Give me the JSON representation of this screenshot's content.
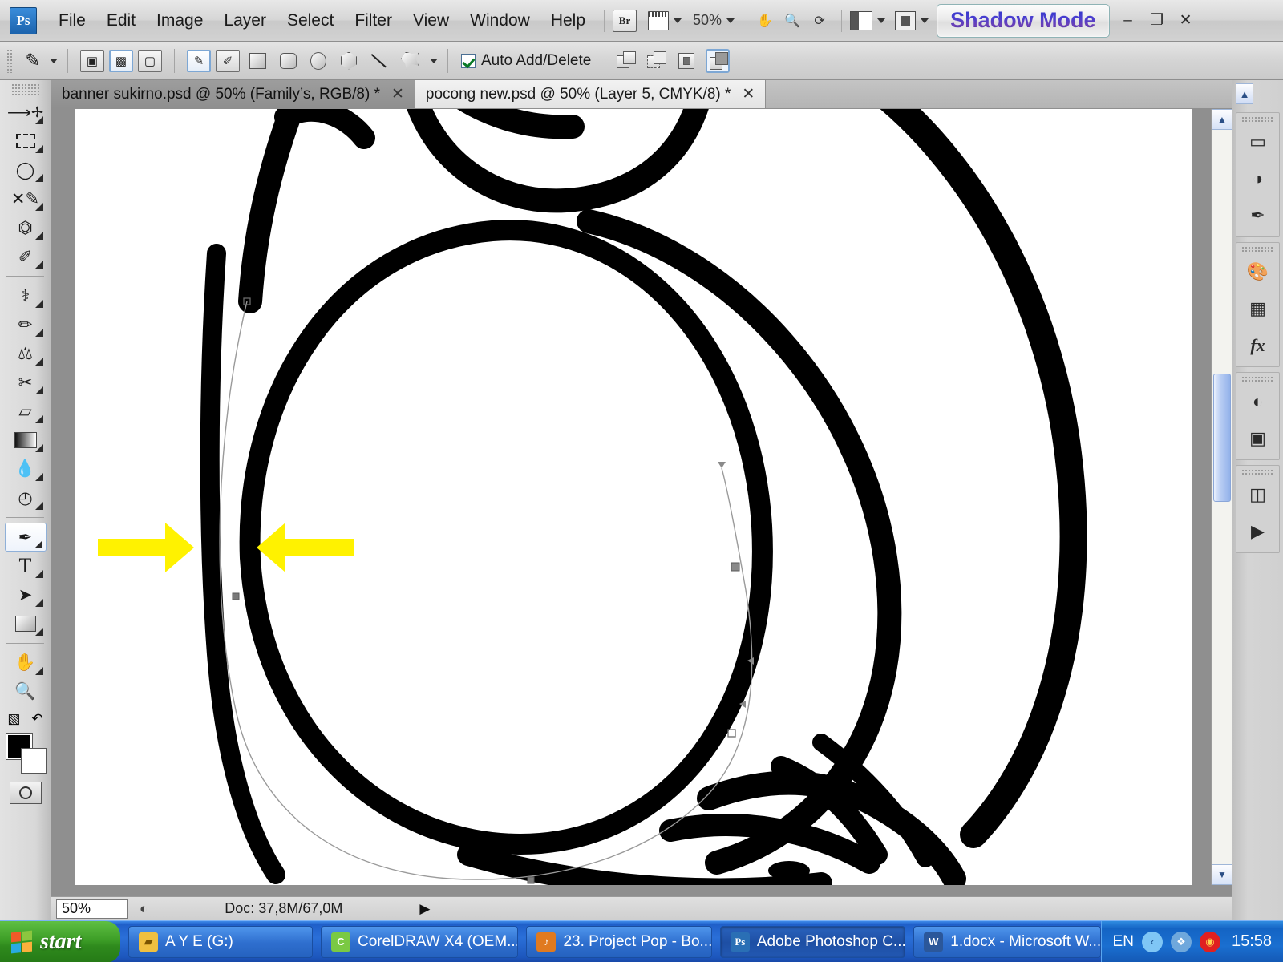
{
  "app": {
    "name": "Adobe Photoshop CS4",
    "logo_text": "Ps"
  },
  "menubar": {
    "items": [
      {
        "label": "File"
      },
      {
        "label": "Edit"
      },
      {
        "label": "Image"
      },
      {
        "label": "Layer"
      },
      {
        "label": "Select"
      },
      {
        "label": "Filter"
      },
      {
        "label": "View"
      },
      {
        "label": "Window"
      },
      {
        "label": "Help"
      }
    ],
    "bridge_label": "Br",
    "zoom_level": "50%",
    "shadow_mode_label": "Shadow Mode",
    "window_buttons": {
      "minimize": "–",
      "restore": "❐",
      "close": "✕"
    },
    "icons": {
      "bridge": "bridge-icon",
      "arrange": "arrange-documents-icon",
      "hand": "hand-tool-icon",
      "zoom": "zoom-tool-icon",
      "rotate": "rotate-view-icon",
      "screen": "screen-mode-icon",
      "view_extras": "view-extras-icon"
    }
  },
  "options_bar": {
    "tool_preset_label": "pen-tool-preset",
    "mode_buttons": [
      "shape-layers",
      "paths",
      "fill-pixels"
    ],
    "selected_mode": "paths",
    "shape_tools": [
      "pen-tool",
      "freeform-pen-tool",
      "rectangle-tool",
      "rounded-rectangle-tool",
      "ellipse-tool",
      "polygon-tool",
      "line-tool",
      "custom-shape-tool"
    ],
    "selected_shape_tool": "pen-tool",
    "auto_add_delete": {
      "label": "Auto Add/Delete",
      "checked": true
    },
    "path_ops": [
      "add-to-path-area",
      "subtract-from-path-area",
      "intersect-path-areas",
      "exclude-overlapping-path-areas"
    ],
    "selected_path_op": "exclude-overlapping-path-areas"
  },
  "tabs": [
    {
      "label": "banner sukirno.psd @ 50% (Family’s, RGB/8) *",
      "close": "✕",
      "active": true
    },
    {
      "label": "pocong new.psd @ 50% (Layer 5, CMYK/8) *",
      "close": "✕",
      "active": false
    }
  ],
  "toolbox": {
    "tools": [
      {
        "name": "move-tool",
        "glyph": "↖"
      },
      {
        "name": "rectangular-marquee-tool",
        "glyph": "⬚"
      },
      {
        "name": "lasso-tool",
        "glyph": "○"
      },
      {
        "name": "quick-selection-tool",
        "glyph": "✒"
      },
      {
        "name": "crop-tool",
        "glyph": "⧉"
      },
      {
        "name": "eyedropper-tool",
        "glyph": "✐"
      },
      {
        "name": "spot-healing-brush-tool",
        "glyph": "⚗"
      },
      {
        "name": "brush-tool",
        "glyph": "✎"
      },
      {
        "name": "clone-stamp-tool",
        "glyph": "⚒"
      },
      {
        "name": "history-brush-tool",
        "glyph": "✄"
      },
      {
        "name": "eraser-tool",
        "glyph": "▱"
      },
      {
        "name": "gradient-tool",
        "glyph": "▤"
      },
      {
        "name": "blur-tool",
        "glyph": "●"
      },
      {
        "name": "dodge-tool",
        "glyph": "◔"
      },
      {
        "name": "pen-tool",
        "glyph": "✑",
        "selected": true
      },
      {
        "name": "horizontal-type-tool",
        "glyph": "T"
      },
      {
        "name": "path-selection-tool",
        "glyph": "➤"
      },
      {
        "name": "rectangle-shape-tool",
        "glyph": "▭"
      },
      {
        "name": "hand-tool",
        "glyph": "✋"
      },
      {
        "name": "zoom-tool",
        "glyph": "⚲"
      }
    ],
    "foreground_color": "#000000",
    "background_color": "#ffffff",
    "quick_mask_label": "edit-in-quick-mask-mode"
  },
  "canvas": {
    "document": "pocong new.psd",
    "zoom": "50%",
    "annotation_arrow_color": "#FFF200",
    "arrows": [
      {
        "name": "annotation-arrow-right",
        "direction": "right"
      },
      {
        "name": "annotation-arrow-left",
        "direction": "left"
      }
    ],
    "artwork_description": "black ink outline drawing with active pen path and anchor points"
  },
  "statusbar": {
    "zoom_value": "50%",
    "doc_info": "Doc: 37,8M/67,0M",
    "play_glyph": "▶",
    "left_arrow_glyph": "‹",
    "right_arrow_glyph": "›"
  },
  "right_panel": {
    "collapse_glyph": "▲",
    "groups": [
      {
        "icons": [
          {
            "name": "layers-panel-icon",
            "glyph": "⬛"
          },
          {
            "name": "channels-panel-icon",
            "glyph": "◑"
          },
          {
            "name": "paths-panel-icon",
            "glyph": "✒"
          }
        ]
      },
      {
        "icons": [
          {
            "name": "color-panel-icon",
            "glyph": "◕"
          },
          {
            "name": "swatches-panel-icon",
            "glyph": "▦"
          },
          {
            "name": "styles-panel-icon",
            "glyph": "fx"
          }
        ]
      },
      {
        "icons": [
          {
            "name": "adjustments-panel-icon",
            "glyph": "◐"
          },
          {
            "name": "masks-panel-icon",
            "glyph": "▣"
          }
        ]
      },
      {
        "icons": [
          {
            "name": "history-panel-icon",
            "glyph": "☷"
          },
          {
            "name": "actions-panel-icon",
            "glyph": "▶"
          }
        ]
      }
    ]
  },
  "taskbar": {
    "start_label": "start",
    "items": [
      {
        "label": "A Y E (G:)",
        "icon": "folder-icon",
        "icon_color": "#f0c040",
        "icon_text": "▤",
        "active": false
      },
      {
        "label": "CorelDRAW X4 (OEM...",
        "icon": "coreldraw-icon",
        "icon_color": "#7ac943",
        "icon_text": "C",
        "active": false
      },
      {
        "label": "23. Project Pop - Bo...",
        "icon": "media-player-icon",
        "icon_color": "#e07a20",
        "icon_text": "♪",
        "active": false
      },
      {
        "label": "Adobe Photoshop C...",
        "icon": "photoshop-icon",
        "icon_color": "#2a6fb5",
        "icon_text": "Ps",
        "active": true
      },
      {
        "label": "1.docx - Microsoft W...",
        "icon": "word-icon",
        "icon_color": "#2b579a",
        "icon_text": "W",
        "active": false
      }
    ],
    "tray": {
      "language": "EN",
      "icons": [
        {
          "name": "show-hidden-icons-button",
          "glyph": "‹",
          "color": "#7fc6f5"
        },
        {
          "name": "network-icon",
          "glyph": "❖",
          "color": "#6fa8dc"
        },
        {
          "name": "antivirus-icon",
          "glyph": "◉",
          "color": "#e02020"
        }
      ],
      "clock": "15:58"
    }
  }
}
